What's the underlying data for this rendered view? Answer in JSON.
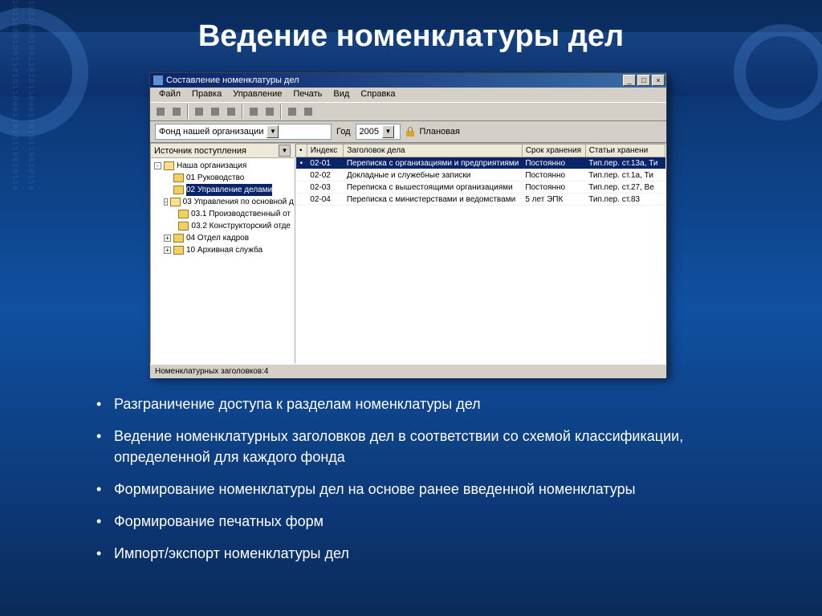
{
  "slide": {
    "title": "Ведение номенклатуры дел",
    "bullets": [
      "Разграничение доступа к разделам номенклатуры дел",
      "Ведение номенклатурных заголовков дел в соответствии со схемой классификации, определенной для каждого фонда",
      "Формирование номенклатуры дел на основе ранее введенной номенклатуры",
      "Формирование печатных форм",
      "Импорт/экспорт номенклатуры дел"
    ]
  },
  "app": {
    "title": "Составление номенклатуры дел",
    "menu": [
      "Файл",
      "Правка",
      "Управление",
      "Печать",
      "Вид",
      "Справка"
    ],
    "win_min": "_",
    "win_max": "□",
    "win_close": "×",
    "filter": {
      "fund": "Фонд нашей организации",
      "year_label": "Год",
      "year": "2005",
      "plan_label": "Плановая"
    },
    "tree": {
      "header": "Источник поступления",
      "root": "Наша организация",
      "items": [
        {
          "level": 1,
          "exp": "",
          "label": "01 Руководство"
        },
        {
          "level": 1,
          "exp": "",
          "label": "02 Управление делами",
          "sel": true
        },
        {
          "level": 1,
          "exp": "-",
          "label": "03 Управления по основной д"
        },
        {
          "level": 2,
          "exp": "",
          "label": "03.1 Производственный от"
        },
        {
          "level": 2,
          "exp": "",
          "label": "03.2 Конструкторский отде"
        },
        {
          "level": 1,
          "exp": "+",
          "label": "04 Отдел кадров"
        },
        {
          "level": 1,
          "exp": "+",
          "label": "10 Архивная служба"
        }
      ]
    },
    "grid": {
      "cols": {
        "mark": "•",
        "idx": "Индекс",
        "title": "Заголовок дела",
        "term": "Срок хранения",
        "art": "Статьи хранени"
      },
      "rows": [
        {
          "mark": "•",
          "idx": "02-01",
          "title": "Переписка с организациями и предприятиями",
          "term": "Постоянно",
          "art": "Тип.пер. ст.13а, Ти",
          "sel": true
        },
        {
          "mark": "",
          "idx": "02-02",
          "title": "Докладные и служебные записки",
          "term": "Постоянно",
          "art": "Тип.пер. ст.1а, Ти"
        },
        {
          "mark": "",
          "idx": "02-03",
          "title": "Переписка с вышестоящими организациями",
          "term": "Постоянно",
          "art": "Тип.пер. ст.27, Ве"
        },
        {
          "mark": "",
          "idx": "02-04",
          "title": "Переписка с министерствами и ведомствами",
          "term": "5 лет ЭПК",
          "art": "Тип.пер. ст.83"
        }
      ]
    },
    "status": "Номенклатурных заголовков:4"
  },
  "bgstream": "1011000100110101100011010110010110"
}
